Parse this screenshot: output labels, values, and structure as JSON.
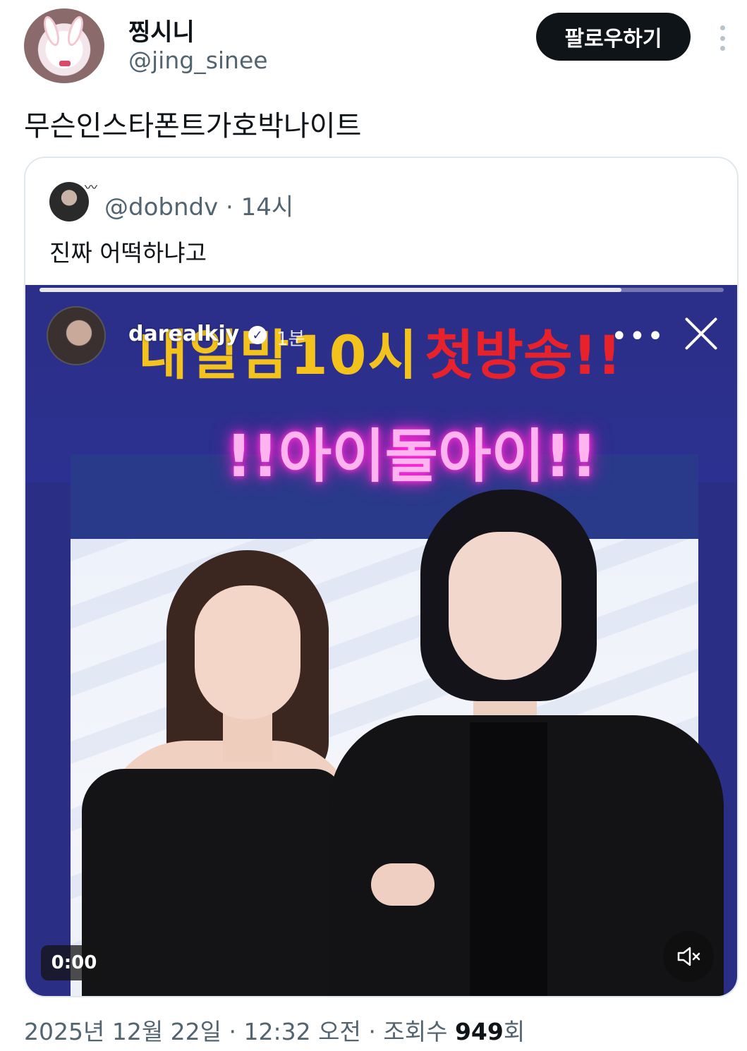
{
  "author": {
    "display_name": "찡시니",
    "handle": "@jing_sinee",
    "avatar_icon": "bunny-avatar"
  },
  "actions": {
    "follow_label": "팔로우하기",
    "more_icon": "vertical-more-icon"
  },
  "tweet": {
    "text": "무슨인스타폰트가호박나이트"
  },
  "quote": {
    "handle": "@dobndv",
    "separator": "·",
    "time": "14시",
    "text": "진짜 어떡하냐고"
  },
  "video": {
    "progress": 0.85,
    "story_user": "darealkjy",
    "story_time": "1분",
    "headline_yellow": "내일밤10시",
    "headline_red": "첫방송!!",
    "neon_title": "!!아이돌아이!!",
    "timecode": "0:00",
    "mute_icon": "speaker-muted-icon",
    "close_icon": "close-icon",
    "more_icon": "horizontal-more-icon"
  },
  "meta": {
    "date": "2025년 12월 22일",
    "sep1": "·",
    "time": "12:32 오전",
    "sep2": "·",
    "views_label": "조회수",
    "views_count": "949",
    "views_suffix": "회"
  },
  "colors": {
    "primary_text": "#0f1419",
    "secondary_text": "#536471",
    "button_bg": "#0f1419",
    "video_bg": "#2a2f85",
    "neon_pink": "#ff2bd6",
    "headline_yellow": "#f4c21c",
    "headline_red": "#e8222a"
  }
}
